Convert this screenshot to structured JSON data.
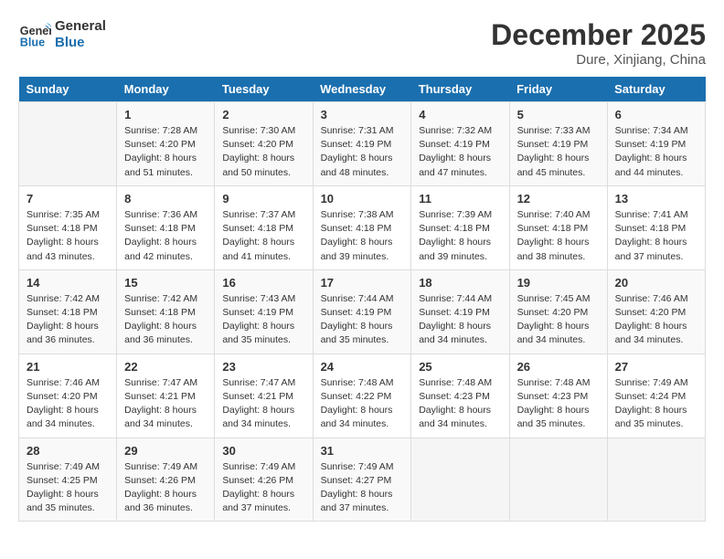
{
  "header": {
    "logo_line1": "General",
    "logo_line2": "Blue",
    "month": "December 2025",
    "location": "Dure, Xinjiang, China"
  },
  "weekdays": [
    "Sunday",
    "Monday",
    "Tuesday",
    "Wednesday",
    "Thursday",
    "Friday",
    "Saturday"
  ],
  "weeks": [
    [
      {
        "day": "",
        "info": ""
      },
      {
        "day": "1",
        "info": "Sunrise: 7:28 AM\nSunset: 4:20 PM\nDaylight: 8 hours\nand 51 minutes."
      },
      {
        "day": "2",
        "info": "Sunrise: 7:30 AM\nSunset: 4:20 PM\nDaylight: 8 hours\nand 50 minutes."
      },
      {
        "day": "3",
        "info": "Sunrise: 7:31 AM\nSunset: 4:19 PM\nDaylight: 8 hours\nand 48 minutes."
      },
      {
        "day": "4",
        "info": "Sunrise: 7:32 AM\nSunset: 4:19 PM\nDaylight: 8 hours\nand 47 minutes."
      },
      {
        "day": "5",
        "info": "Sunrise: 7:33 AM\nSunset: 4:19 PM\nDaylight: 8 hours\nand 45 minutes."
      },
      {
        "day": "6",
        "info": "Sunrise: 7:34 AM\nSunset: 4:19 PM\nDaylight: 8 hours\nand 44 minutes."
      }
    ],
    [
      {
        "day": "7",
        "info": "Sunrise: 7:35 AM\nSunset: 4:18 PM\nDaylight: 8 hours\nand 43 minutes."
      },
      {
        "day": "8",
        "info": "Sunrise: 7:36 AM\nSunset: 4:18 PM\nDaylight: 8 hours\nand 42 minutes."
      },
      {
        "day": "9",
        "info": "Sunrise: 7:37 AM\nSunset: 4:18 PM\nDaylight: 8 hours\nand 41 minutes."
      },
      {
        "day": "10",
        "info": "Sunrise: 7:38 AM\nSunset: 4:18 PM\nDaylight: 8 hours\nand 39 minutes."
      },
      {
        "day": "11",
        "info": "Sunrise: 7:39 AM\nSunset: 4:18 PM\nDaylight: 8 hours\nand 39 minutes."
      },
      {
        "day": "12",
        "info": "Sunrise: 7:40 AM\nSunset: 4:18 PM\nDaylight: 8 hours\nand 38 minutes."
      },
      {
        "day": "13",
        "info": "Sunrise: 7:41 AM\nSunset: 4:18 PM\nDaylight: 8 hours\nand 37 minutes."
      }
    ],
    [
      {
        "day": "14",
        "info": "Sunrise: 7:42 AM\nSunset: 4:18 PM\nDaylight: 8 hours\nand 36 minutes."
      },
      {
        "day": "15",
        "info": "Sunrise: 7:42 AM\nSunset: 4:18 PM\nDaylight: 8 hours\nand 36 minutes."
      },
      {
        "day": "16",
        "info": "Sunrise: 7:43 AM\nSunset: 4:19 PM\nDaylight: 8 hours\nand 35 minutes."
      },
      {
        "day": "17",
        "info": "Sunrise: 7:44 AM\nSunset: 4:19 PM\nDaylight: 8 hours\nand 35 minutes."
      },
      {
        "day": "18",
        "info": "Sunrise: 7:44 AM\nSunset: 4:19 PM\nDaylight: 8 hours\nand 34 minutes."
      },
      {
        "day": "19",
        "info": "Sunrise: 7:45 AM\nSunset: 4:20 PM\nDaylight: 8 hours\nand 34 minutes."
      },
      {
        "day": "20",
        "info": "Sunrise: 7:46 AM\nSunset: 4:20 PM\nDaylight: 8 hours\nand 34 minutes."
      }
    ],
    [
      {
        "day": "21",
        "info": "Sunrise: 7:46 AM\nSunset: 4:20 PM\nDaylight: 8 hours\nand 34 minutes."
      },
      {
        "day": "22",
        "info": "Sunrise: 7:47 AM\nSunset: 4:21 PM\nDaylight: 8 hours\nand 34 minutes."
      },
      {
        "day": "23",
        "info": "Sunrise: 7:47 AM\nSunset: 4:21 PM\nDaylight: 8 hours\nand 34 minutes."
      },
      {
        "day": "24",
        "info": "Sunrise: 7:48 AM\nSunset: 4:22 PM\nDaylight: 8 hours\nand 34 minutes."
      },
      {
        "day": "25",
        "info": "Sunrise: 7:48 AM\nSunset: 4:23 PM\nDaylight: 8 hours\nand 34 minutes."
      },
      {
        "day": "26",
        "info": "Sunrise: 7:48 AM\nSunset: 4:23 PM\nDaylight: 8 hours\nand 35 minutes."
      },
      {
        "day": "27",
        "info": "Sunrise: 7:49 AM\nSunset: 4:24 PM\nDaylight: 8 hours\nand 35 minutes."
      }
    ],
    [
      {
        "day": "28",
        "info": "Sunrise: 7:49 AM\nSunset: 4:25 PM\nDaylight: 8 hours\nand 35 minutes."
      },
      {
        "day": "29",
        "info": "Sunrise: 7:49 AM\nSunset: 4:26 PM\nDaylight: 8 hours\nand 36 minutes."
      },
      {
        "day": "30",
        "info": "Sunrise: 7:49 AM\nSunset: 4:26 PM\nDaylight: 8 hours\nand 37 minutes."
      },
      {
        "day": "31",
        "info": "Sunrise: 7:49 AM\nSunset: 4:27 PM\nDaylight: 8 hours\nand 37 minutes."
      },
      {
        "day": "",
        "info": ""
      },
      {
        "day": "",
        "info": ""
      },
      {
        "day": "",
        "info": ""
      }
    ]
  ]
}
